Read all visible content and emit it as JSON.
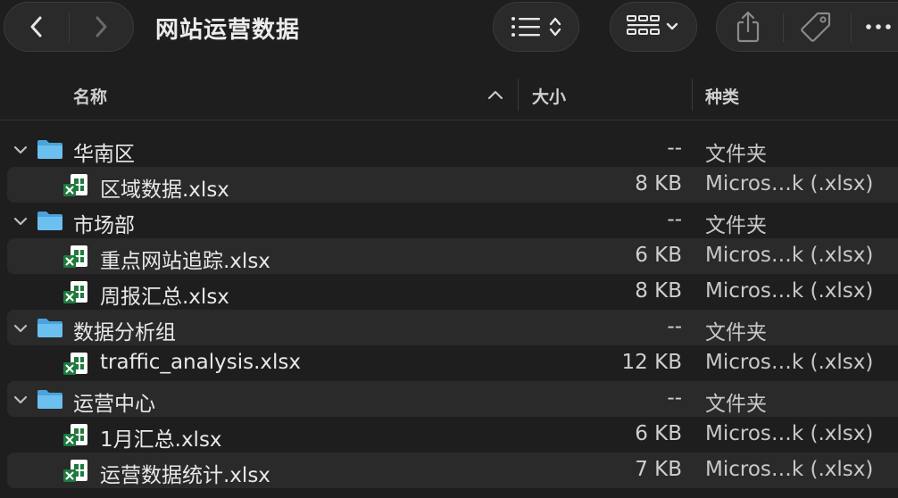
{
  "window": {
    "title": "网站运营数据"
  },
  "toolbar": {
    "back_icon": "chevron-left-icon",
    "forward_icon": "chevron-right-icon",
    "sort_icon": "list-sort-icon",
    "view_icon": "grid-view-icon",
    "share_icon": "share-icon",
    "tag_icon": "tag-icon",
    "more_icon": "more-icon"
  },
  "columns": {
    "name": "名称",
    "size": "大小",
    "kind": "种类"
  },
  "rows": [
    {
      "type": "folder",
      "name": "华南区",
      "size": "--",
      "kind": "文件夹",
      "expanded": true
    },
    {
      "type": "file",
      "name": "区域数据.xlsx",
      "size": "8 KB",
      "kind": "Micros…k (.xlsx)"
    },
    {
      "type": "folder",
      "name": "市场部",
      "size": "--",
      "kind": "文件夹",
      "expanded": true
    },
    {
      "type": "file",
      "name": "重点网站追踪.xlsx",
      "size": "6 KB",
      "kind": "Micros…k (.xlsx)"
    },
    {
      "type": "file",
      "name": "周报汇总.xlsx",
      "size": "8 KB",
      "kind": "Micros…k (.xlsx)"
    },
    {
      "type": "folder",
      "name": "数据分析组",
      "size": "--",
      "kind": "文件夹",
      "expanded": true
    },
    {
      "type": "file",
      "name": "traffic_analysis.xlsx",
      "size": "12 KB",
      "kind": "Micros…k (.xlsx)"
    },
    {
      "type": "folder",
      "name": "运营中心",
      "size": "--",
      "kind": "文件夹",
      "expanded": true
    },
    {
      "type": "file",
      "name": "1月汇总.xlsx",
      "size": "6 KB",
      "kind": "Micros…k (.xlsx)"
    },
    {
      "type": "file",
      "name": "运营数据统计.xlsx",
      "size": "7 KB",
      "kind": "Micros…k (.xlsx)"
    }
  ],
  "colors": {
    "background": "#1e1e1e",
    "stripe": "#2a2a2a",
    "folder": "#5bb4e8",
    "excel_green": "#1f7a3e"
  }
}
